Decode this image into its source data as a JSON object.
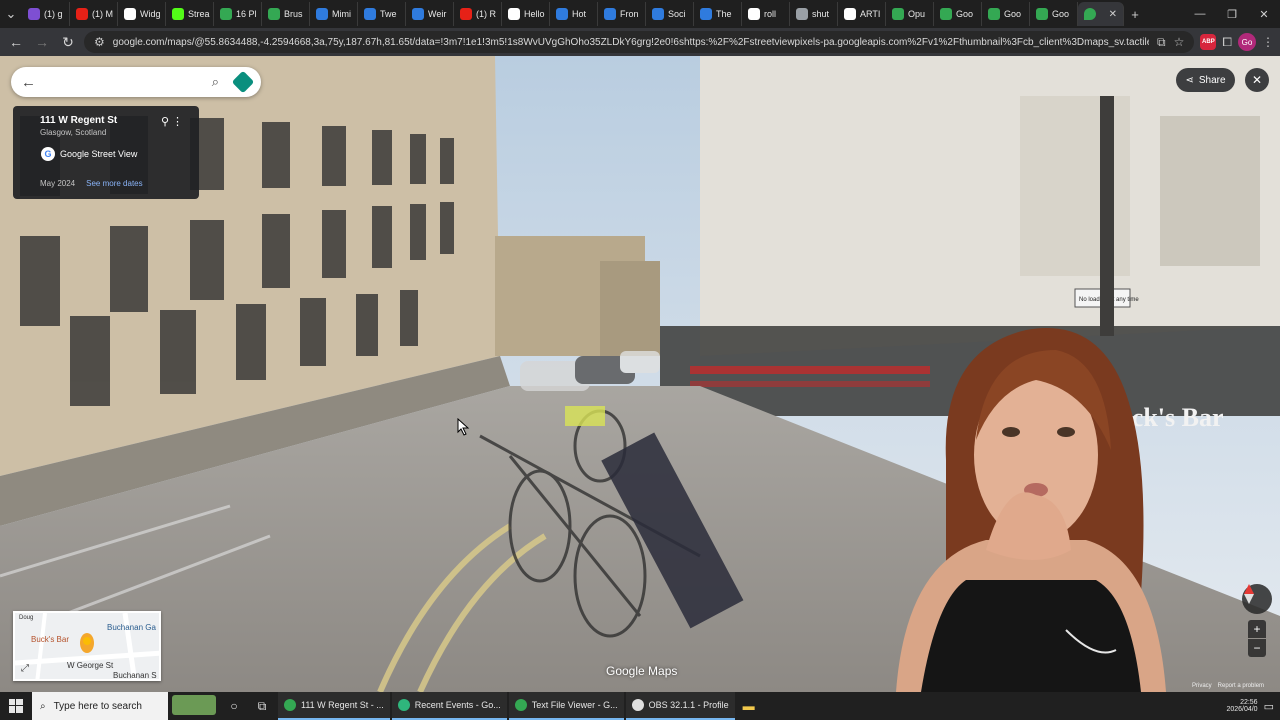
{
  "browser": {
    "tabs": [
      {
        "label": "(1) g",
        "color": "#7e4fd3"
      },
      {
        "label": "(1) M",
        "color": "#e62117"
      },
      {
        "label": "Widg",
        "color": "#ffffff"
      },
      {
        "label": "Strea",
        "color": "#53fc18"
      },
      {
        "label": "16 Pl",
        "color": "#34a853"
      },
      {
        "label": "Brus",
        "color": "#34a853"
      },
      {
        "label": "Mimi",
        "color": "#2f7bde"
      },
      {
        "label": "Twe",
        "color": "#2f7bde"
      },
      {
        "label": "Weir",
        "color": "#2f7bde"
      },
      {
        "label": "(1) R",
        "color": "#e62117"
      },
      {
        "label": "Hello",
        "color": "#ffffff"
      },
      {
        "label": "Hot",
        "color": "#2f7bde"
      },
      {
        "label": "Fron",
        "color": "#2f7bde"
      },
      {
        "label": "Soci",
        "color": "#2f7bde"
      },
      {
        "label": "The",
        "color": "#2f7bde"
      },
      {
        "label": "roll",
        "color": "#ffffff"
      },
      {
        "label": "shut",
        "color": "#9aa0a6"
      },
      {
        "label": "ARTI",
        "color": "#ffffff"
      },
      {
        "label": "Opu",
        "color": "#34a853"
      },
      {
        "label": "Goo",
        "color": "#34a853"
      },
      {
        "label": "Goo",
        "color": "#34a853"
      },
      {
        "label": "Goo",
        "color": "#34a853"
      }
    ],
    "active_tab_color": "#34a853",
    "new_tab_label": "+",
    "url": "google.com/maps/@55.8634488,-4.2594668,3a,75y,187.67h,81.65t/data=!3m7!1e1!3m5!1s8WvUVgGhOho35ZLDkY6grg!2e0!6shttps:%2F%2Fstreetviewpixels-pa.googleapis.com%2Fv1%2Fthumbnail%3Fcb_client%3Dmaps_sv.tactile%26w%3D90...",
    "extensions": [
      "ABP",
      "Go"
    ]
  },
  "streetview": {
    "info_title": "111 W Regent St",
    "info_subtitle": "Glasgow, Scotland",
    "source_label": "Google Street View",
    "capture_date": "May 2024",
    "more_dates_label": "See more dates",
    "share_label": "Share",
    "watermark": "Google Maps",
    "scene_signs": [
      "Buck's Bar",
      "No loading at any time"
    ],
    "minimap_labels": [
      "Buck's Bar",
      "Buchanan Ga",
      "W George St",
      "Buchanan S",
      "Doug"
    ],
    "footer_links": [
      "Privacy",
      "Report a problem"
    ]
  },
  "taskbar": {
    "search_placeholder": "Type here to search",
    "apps": [
      {
        "label": "111 W Regent St - ...",
        "color": "#34a853"
      },
      {
        "label": "Recent Events - Go...",
        "color": "#2fb67c"
      },
      {
        "label": "Text File Viewer - G...",
        "color": "#34a853"
      },
      {
        "label": "OBS 32.1.1 - Profile",
        "color": "#e0e0e0"
      }
    ],
    "time": "22:56",
    "date": "2026/04/0"
  },
  "colors": {
    "browser_bg": "#1f1f1f",
    "toolbar_bg": "#35363a",
    "info_card_bg": "#202124",
    "link": "#8ab4f8",
    "taskbar_bg": "#202020"
  }
}
